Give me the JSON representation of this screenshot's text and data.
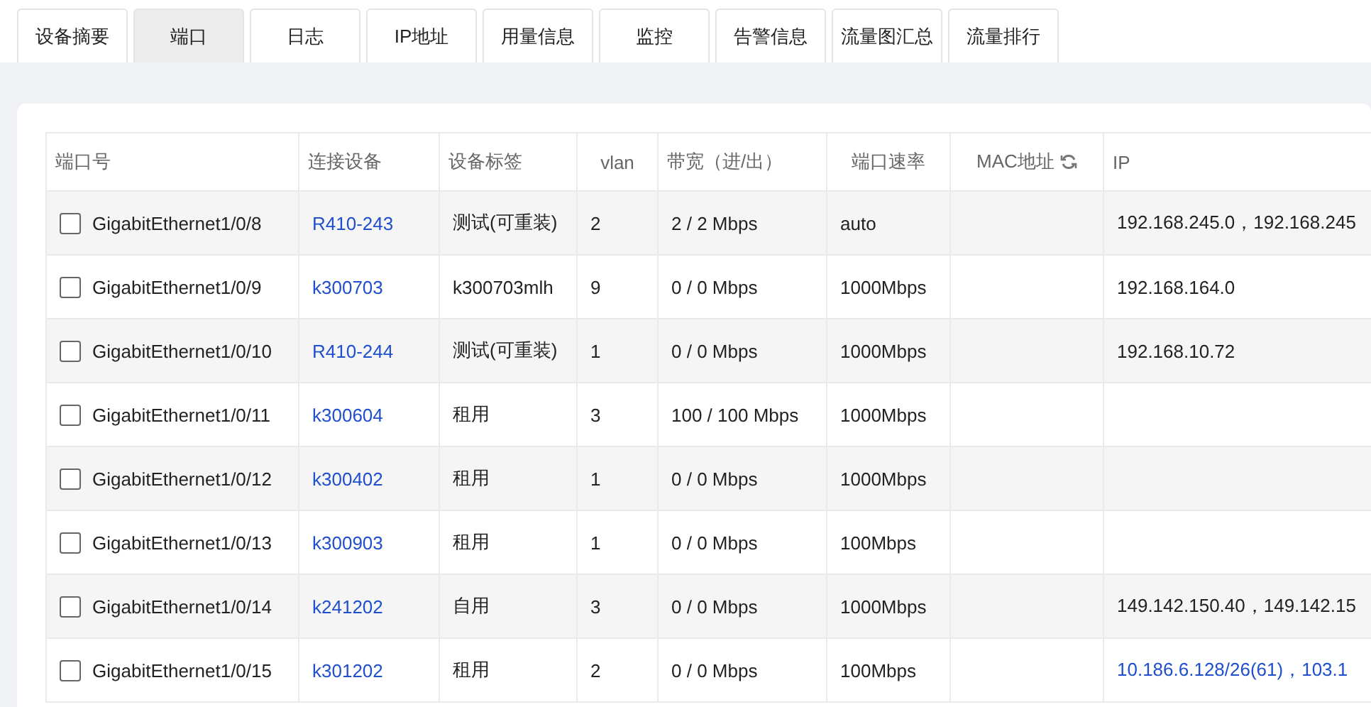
{
  "tabs": [
    {
      "label": "设备摘要",
      "selected": false
    },
    {
      "label": "端口",
      "selected": true
    },
    {
      "label": "日志",
      "selected": false
    },
    {
      "label": "IP地址",
      "selected": false
    },
    {
      "label": "用量信息",
      "selected": false
    },
    {
      "label": "监控",
      "selected": false
    },
    {
      "label": "告警信息",
      "selected": false
    },
    {
      "label": "流量图汇总",
      "selected": false
    },
    {
      "label": "流量排行",
      "selected": false
    }
  ],
  "table": {
    "columns": [
      "端口号",
      "连接设备",
      "设备标签",
      "vlan",
      "带宽（进/出）",
      "端口速率",
      "MAC地址",
      "IP"
    ],
    "rows": [
      {
        "checked": false,
        "port": "GigabitEthernet1/0/8",
        "device": "R410-243",
        "tag": "测试(可重装)",
        "vlan": "2",
        "bandwidth": "2 / 2 Mbps",
        "speed": "auto",
        "ip": "192.168.245.0，192.168.245",
        "ip_link": false
      },
      {
        "checked": false,
        "port": "GigabitEthernet1/0/9",
        "device": "k300703",
        "tag": "k300703mlh",
        "vlan": "9",
        "bandwidth": "0 / 0 Mbps",
        "speed": "1000Mbps",
        "ip": "192.168.164.0",
        "ip_link": false
      },
      {
        "checked": false,
        "port": "GigabitEthernet1/0/10",
        "device": "R410-244",
        "tag": "测试(可重装)",
        "vlan": "1",
        "bandwidth": "0 / 0 Mbps",
        "speed": "1000Mbps",
        "ip": "192.168.10.72",
        "ip_link": false
      },
      {
        "checked": false,
        "port": "GigabitEthernet1/0/11",
        "device": "k300604",
        "tag": "租用",
        "vlan": "3",
        "bandwidth": "100 / 100 Mbps",
        "speed": "1000Mbps"
      },
      {
        "checked": false,
        "port": "GigabitEthernet1/0/12",
        "device": "k300402",
        "tag": "租用",
        "vlan": "1",
        "bandwidth": "0 / 0 Mbps",
        "speed": "1000Mbps"
      },
      {
        "checked": false,
        "port": "GigabitEthernet1/0/13",
        "device": "k300903",
        "tag": "租用",
        "vlan": "1",
        "bandwidth": "0 / 0 Mbps",
        "speed": "100Mbps"
      },
      {
        "checked": false,
        "port": "GigabitEthernet1/0/14",
        "device": "k241202",
        "tag": "自用",
        "vlan": "3",
        "bandwidth": "0 / 0 Mbps",
        "speed": "1000Mbps",
        "ip": "149.142.150.40，149.142.15",
        "ip_link": false
      },
      {
        "checked": false,
        "port": "GigabitEthernet1/0/15",
        "device": "k301202",
        "tag": "租用",
        "vlan": "2",
        "bandwidth": "0 / 0 Mbps",
        "speed": "100Mbps",
        "ip": "10.186.6.128/26(61)，103.1",
        "ip_link": true
      }
    ]
  }
}
